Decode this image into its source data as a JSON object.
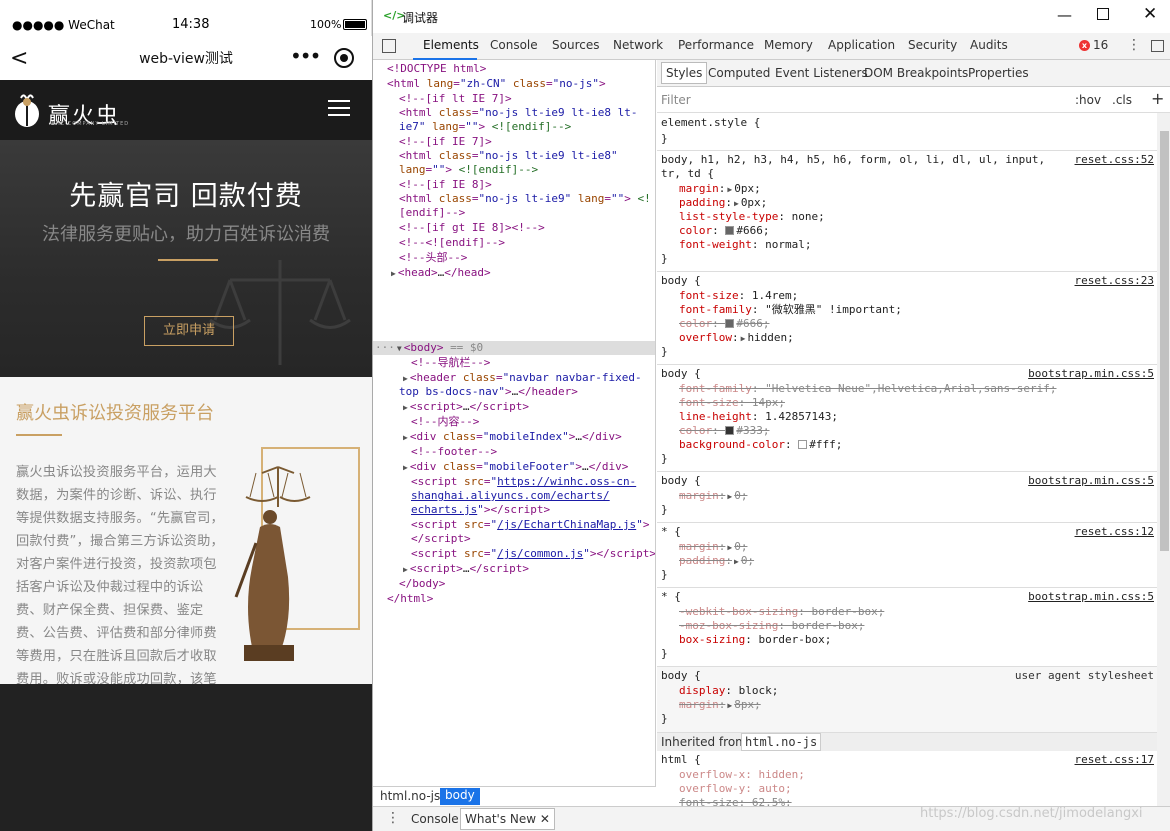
{
  "phone": {
    "status": {
      "signal": "●●●●● WeChat",
      "time": "14:38",
      "battery": "100%"
    },
    "nav": {
      "title": "web-view测试",
      "back": "<",
      "more": "•••"
    },
    "site": {
      "logo": "赢火虫",
      "logo_sub": "WHC COMPANY LIMITED"
    },
    "hero": {
      "title": "先赢官司  回款付费",
      "subtitle": "法律服务更贴心，助力百姓诉讼消费",
      "button": "立即申请"
    },
    "content": {
      "title": "赢火虫诉讼投资服务平台",
      "paragraph": "赢火虫诉讼投资服务平台，运用大数据，为案件的诊断、诉讼、执行等提供数据支持服务。“先赢官司，回款付费”，撮合第三方诉讼资助，对客户案件进行投资，投资款项包括客户诉讼及仲裁过程中的诉讼费、财产保全费、担保费、鉴定费、公告费、评估费和部分律师费等费用，只在胜诉且回款后才收取费用。败诉或没能成功回款，该笔投资的费用由第三方机构承担，"
    }
  },
  "devtools": {
    "window_title": "调试器",
    "tabs": [
      "Elements",
      "Console",
      "Sources",
      "Network",
      "Performance",
      "Memory",
      "Application",
      "Security",
      "Audits"
    ],
    "active_tab": "Elements",
    "error_count": "16",
    "breadcrumb": [
      "html.no-js",
      "body"
    ],
    "styles_tabs": [
      "Styles",
      "Computed",
      "Event Listeners",
      "DOM Breakpoints",
      "Properties"
    ],
    "filter_placeholder": "Filter",
    "hov": ":hov",
    "cls": ".cls",
    "inherited_label": "Inherited from",
    "inherited_tag": "html.no-js",
    "drawer_tabs": [
      "Console",
      "What's New"
    ],
    "watermark": "https://blog.csdn.net/jimodelangxi"
  }
}
